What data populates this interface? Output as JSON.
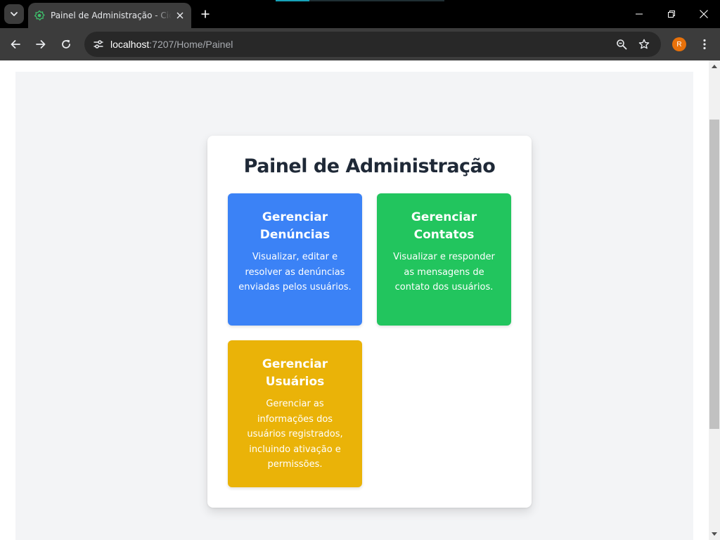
{
  "browser": {
    "tab_title": "Painel de Administração - Cidade Limpa",
    "url_host": "localhost",
    "url_path": ":7207/Home/Painel",
    "profile_initial": "R",
    "accent_color": "#e8710a"
  },
  "panel": {
    "title": "Painel de Administração",
    "cards": [
      {
        "title": "Gerenciar Denúncias",
        "description": "Visualizar, editar e resolver as denúncias enviadas pelos usuários.",
        "color": "#3b82f6"
      },
      {
        "title": "Gerenciar Contatos",
        "description": "Visualizar e responder as mensagens de contato dos usuários.",
        "color": "#22c55e"
      },
      {
        "title": "Gerenciar Usuários",
        "description": "Gerenciar as informações dos usuários registrados, incluindo ativação e permissões.",
        "color": "#eab308"
      }
    ]
  },
  "icons": {
    "tab_search": "chevron-down-icon",
    "favicon": "puzzle-recycle-icon",
    "tab_close": "close-icon",
    "new_tab": "plus-icon",
    "back": "arrow-left-icon",
    "forward": "arrow-right-icon",
    "reload": "reload-icon",
    "site_info": "tune-icon",
    "zoom": "zoom-icon",
    "bookmark": "star-icon",
    "menu": "kebab-menu-icon"
  }
}
